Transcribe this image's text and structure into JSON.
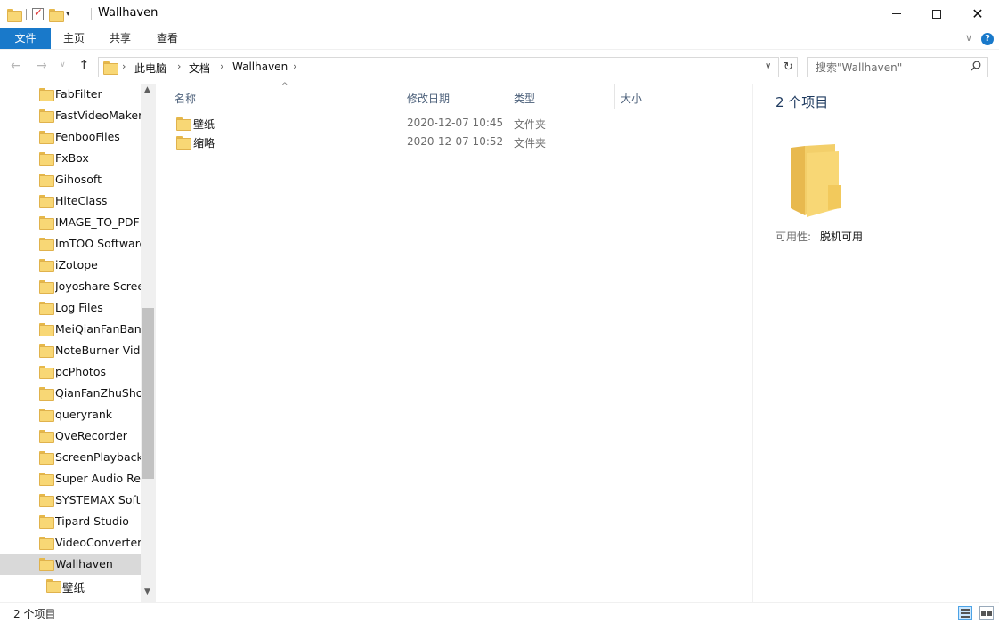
{
  "window": {
    "title": "Wallhaven",
    "icon": "folder-icon",
    "controls": {
      "minimize": "minimize-icon",
      "maximize": "maximize-icon",
      "close": "✕"
    }
  },
  "ribbon": {
    "tabs": [
      {
        "label": "文件",
        "active": true
      },
      {
        "label": "主页"
      },
      {
        "label": "共享"
      },
      {
        "label": "查看"
      }
    ],
    "help": "?"
  },
  "nav": {
    "back": "←",
    "forward": "→",
    "history": "∨",
    "up": "↑"
  },
  "address": {
    "breadcrumbs": [
      "此电脑",
      "文档",
      "Wallhaven"
    ],
    "separator": "›"
  },
  "search": {
    "placeholder": "搜索\"Wallhaven\""
  },
  "tree": {
    "items": [
      {
        "label": "FabFilter"
      },
      {
        "label": "FastVideoMaker"
      },
      {
        "label": "FenbooFiles"
      },
      {
        "label": "FxBox"
      },
      {
        "label": "Gihosoft"
      },
      {
        "label": "HiteClass"
      },
      {
        "label": "IMAGE_TO_PDF"
      },
      {
        "label": "ImTOO Software"
      },
      {
        "label": "iZotope"
      },
      {
        "label": "Joyoshare Scree"
      },
      {
        "label": "Log Files"
      },
      {
        "label": "MeiQianFanBanl"
      },
      {
        "label": "NoteBurner Vide"
      },
      {
        "label": "pcPhotos"
      },
      {
        "label": "QianFanZhuShou"
      },
      {
        "label": "queryrank"
      },
      {
        "label": "QveRecorder"
      },
      {
        "label": "ScreenPlayback.e"
      },
      {
        "label": "Super Audio Rec"
      },
      {
        "label": "SYSTEMAX Softw"
      },
      {
        "label": "Tipard Studio"
      },
      {
        "label": "VideoConverter"
      },
      {
        "label": "Wallhaven",
        "selected": true
      },
      {
        "label": "壁纸",
        "child": true
      }
    ]
  },
  "filelist": {
    "columns": [
      "名称",
      "修改日期",
      "类型",
      "大小"
    ],
    "rows": [
      {
        "name": "壁纸",
        "date": "2020-12-07 10:45",
        "type": "文件夹"
      },
      {
        "name": "缩略",
        "date": "2020-12-07 10:52",
        "type": "文件夹"
      }
    ]
  },
  "details": {
    "count": "2 个项目",
    "availability_label": "可用性:",
    "availability_value": "脱机可用"
  },
  "status": {
    "text": "2 个项目"
  },
  "colors": {
    "accent": "#1979ca",
    "folder": "#f8d775",
    "selection": "#d9d9d9"
  }
}
